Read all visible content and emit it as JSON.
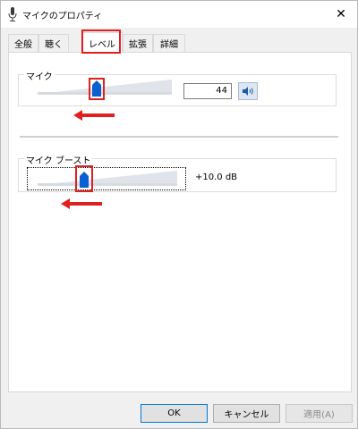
{
  "window": {
    "title": "マイクのプロパティ"
  },
  "tabs": [
    {
      "label": "全般"
    },
    {
      "label": "聴く"
    },
    {
      "label": "レベル"
    },
    {
      "label": "拡張"
    },
    {
      "label": "詳細"
    }
  ],
  "mic": {
    "label": "マイク",
    "level": "44",
    "slider_value": 44
  },
  "boost": {
    "label": "マイク ブースト",
    "value_text": "+10.0 dB"
  },
  "buttons": {
    "ok": "OK",
    "cancel": "キャンセル",
    "apply": "適用(A)"
  },
  "colors": {
    "accent": "#0a5fd1",
    "highlight": "#e02020"
  }
}
